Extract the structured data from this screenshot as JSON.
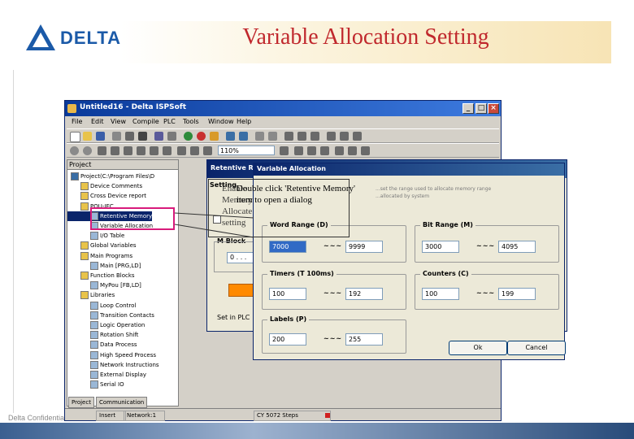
{
  "slide": {
    "logo_text": "DELTA",
    "title": "Variable Allocation Setting",
    "footer": "Delta Confidential"
  },
  "app": {
    "title": "Untitled16 - Delta ISPSoft",
    "menu": [
      "File",
      "Edit",
      "View",
      "Compile",
      "PLC",
      "Tools",
      "Window",
      "Help"
    ],
    "zoom": "110%",
    "project_header": "Project",
    "tree": [
      {
        "label": "Project(C:\\Program Files\\D",
        "indent": 0
      },
      {
        "label": "Device Comments",
        "indent": 1
      },
      {
        "label": "Cross Device report",
        "indent": 1
      },
      {
        "label": "POU-IEC",
        "indent": 1
      },
      {
        "label": "Retentive Memory",
        "indent": 2,
        "selected": true
      },
      {
        "label": "Variable Allocation",
        "indent": 2
      },
      {
        "label": "I/O Table",
        "indent": 2
      },
      {
        "label": "Global Variables",
        "indent": 1
      },
      {
        "label": "Main Programs",
        "indent": 1
      },
      {
        "label": "Main [PRG,LD]",
        "indent": 2
      },
      {
        "label": "Function Blocks",
        "indent": 1
      },
      {
        "label": "MyPou [FB,LD]",
        "indent": 2
      },
      {
        "label": "Libraries",
        "indent": 1
      },
      {
        "label": "Loop Control",
        "indent": 2
      },
      {
        "label": "Transition Contacts",
        "indent": 2
      },
      {
        "label": "Logic Operation",
        "indent": 2
      },
      {
        "label": "Rotation Shift",
        "indent": 2
      },
      {
        "label": "Data Process",
        "indent": 2
      },
      {
        "label": "High Speed Process",
        "indent": 2
      },
      {
        "label": "Network Instructions",
        "indent": 2
      },
      {
        "label": "External Display",
        "indent": 2
      },
      {
        "label": "Serial IO",
        "indent": 2
      }
    ],
    "tabs": [
      "Project",
      "Communication"
    ],
    "status": [
      "Insert",
      "Network:1",
      "CY 5072 Steps"
    ]
  },
  "retentive_dialog": {
    "title": "Retentive Ra",
    "group_label": "M Block",
    "field_value": "0 . . .",
    "bottom_tab": "Set in PLC"
  },
  "variable_dialog": {
    "title": "Variable Allocation",
    "desc_line1": "...set the range used to allocate memory range",
    "desc_line2": "...allocated by system",
    "word_range": {
      "label": "Word Range (D)",
      "from": "7000",
      "to": "9999"
    },
    "bit_range": {
      "label": "Bit Range (M)",
      "from": "3000",
      "to": "4095"
    },
    "timers": {
      "label": "Timers (T   100ms)",
      "from": "100",
      "to": "192"
    },
    "counters": {
      "label": "Counters (C)",
      "from": "100",
      "to": "199"
    },
    "labels": {
      "label": "Labels (P)",
      "from": "200",
      "to": "255"
    },
    "tilde": "~~~",
    "ok_label": "Ok",
    "cancel_label": "Cancel"
  },
  "callout": {
    "head": "Setting",
    "left_col": "Enable Memory Allocate setting",
    "text": "Double click 'Retentive Memory' item to open a dialog"
  }
}
